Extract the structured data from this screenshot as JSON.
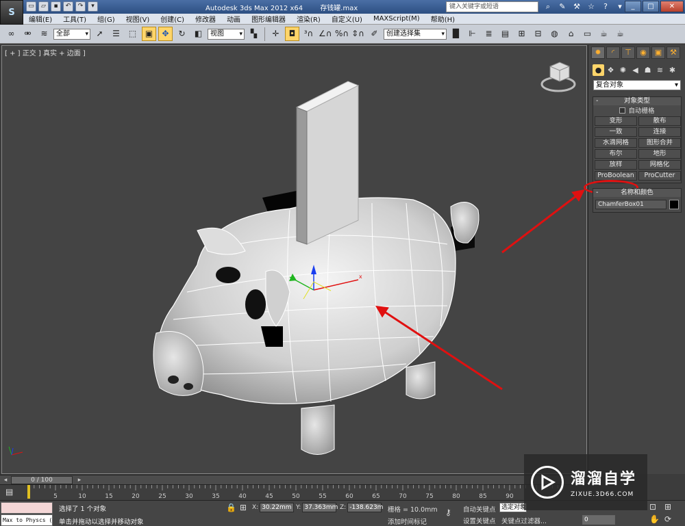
{
  "title": {
    "app": "Autodesk 3ds Max  2012 x64",
    "file": "存钱罐.max",
    "search_placeholder": "键入关键字或短语",
    "app_logo": "S"
  },
  "menu": [
    "编辑(E)",
    "工具(T)",
    "组(G)",
    "视图(V)",
    "创建(C)",
    "修改器",
    "动画",
    "图形编辑器",
    "渲染(R)",
    "自定义(U)",
    "MAXScript(M)",
    "帮助(H)"
  ],
  "toolbar": {
    "filter": "全部",
    "ref_coord": "视图",
    "named_selection": "创建选择集"
  },
  "viewport": {
    "label": "[ + ] 正交 ] 真实 + 边面 ]"
  },
  "command_panel": {
    "category": "复合对象",
    "object_type": {
      "header": "对象类型",
      "autogrid": "自动栅格",
      "buttons": [
        "变形",
        "散布",
        "一致",
        "连接",
        "水滴网格",
        "图形合并",
        "布尔",
        "地形",
        "放样",
        "网格化",
        "ProBoolean",
        "ProCutter"
      ]
    },
    "name_color": {
      "header": "名称和颜色",
      "name": "ChamferBox01",
      "color": "#000000"
    }
  },
  "timeline": {
    "frame": "0 / 100",
    "ticks": [
      "5",
      "10",
      "15",
      "20",
      "25",
      "30",
      "35",
      "40",
      "45",
      "50",
      "55",
      "60",
      "65",
      "70",
      "75",
      "80",
      "85",
      "90"
    ]
  },
  "status": {
    "maxscript_top": "",
    "maxscript_bottom": "Max to Physcs (",
    "selection": "选择了 1 个对象",
    "prompt": "单击并拖动以选择并移动对象",
    "x_label": "X:",
    "x": "30.22mm",
    "y_label": "Y:",
    "y": "37.363mm",
    "z_label": "Z:",
    "z": "-138.623m",
    "grid": "栅格 = 10.0mm",
    "add_time_tag": "添加时间标记",
    "auto_key": "自动关键点",
    "auto_key_mode": "选定对象",
    "set_key": "设置关键点",
    "key_filters": "关键点过滤器...",
    "frame_field": "0"
  },
  "watermark": {
    "main": "溜溜自学",
    "sub": "ZIXUE.3D66.COM"
  }
}
